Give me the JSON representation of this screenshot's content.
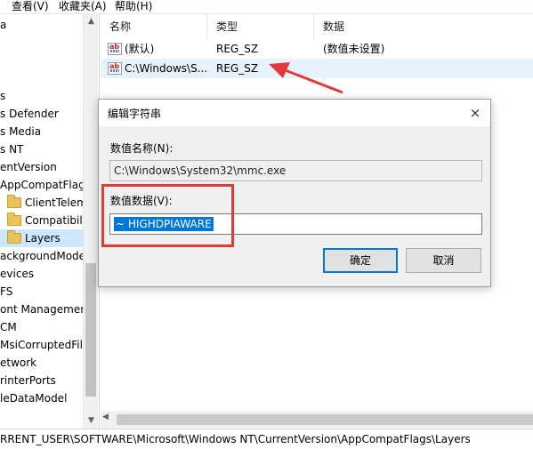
{
  "menu": {
    "view": "查看(V)",
    "favorites": "收藏夹(A)",
    "help": "帮助(H)"
  },
  "tree": {
    "items": [
      {
        "label": "a",
        "folder": false
      },
      {
        "label": "",
        "folder": false
      },
      {
        "label": "",
        "folder": false
      },
      {
        "label": "",
        "folder": false
      },
      {
        "label": "s",
        "folder": false
      },
      {
        "label": "s Defender",
        "folder": false
      },
      {
        "label": "s Media",
        "folder": false
      },
      {
        "label": "s NT",
        "folder": false
      },
      {
        "label": "entVersion",
        "folder": false
      },
      {
        "label": "AppCompatFlags",
        "folder": false
      },
      {
        "label": "ClientTelemetr",
        "folder": true
      },
      {
        "label": "Compatibility A",
        "folder": true
      },
      {
        "label": "Layers",
        "folder": true,
        "selected": true
      },
      {
        "label": "ackgroundMode",
        "folder": false
      },
      {
        "label": "evices",
        "folder": false
      },
      {
        "label": "FS",
        "folder": false
      },
      {
        "label": "ont Management",
        "folder": false
      },
      {
        "label": "CM",
        "folder": false
      },
      {
        "label": "MsiCorruptedFile",
        "folder": false
      },
      {
        "label": "etwork",
        "folder": false
      },
      {
        "label": "rinterPorts",
        "folder": false
      },
      {
        "label": "leDataModel",
        "folder": false
      }
    ]
  },
  "list": {
    "headers": {
      "name": "名称",
      "type": "类型",
      "data": "数据"
    },
    "rows": [
      {
        "name": "(默认)",
        "type": "REG_SZ",
        "data": "(数值未设置)"
      },
      {
        "name": "C:\\Windows\\S...",
        "type": "REG_SZ",
        "data": ""
      }
    ]
  },
  "status_path": "RRENT_USER\\SOFTWARE\\Microsoft\\Windows NT\\CurrentVersion\\AppCompatFlags\\Layers",
  "dialog": {
    "title": "编辑字符串",
    "name_label": "数值名称(N):",
    "name_value": "C:\\Windows\\System32\\mmc.exe",
    "data_label": "数值数据(V):",
    "data_value": "~ HIGHDPIAWARE",
    "ok": "确定",
    "cancel": "取消",
    "close_icon": "×"
  },
  "colors": {
    "annotation": "#e23a3a",
    "selection": "#0078d7"
  }
}
